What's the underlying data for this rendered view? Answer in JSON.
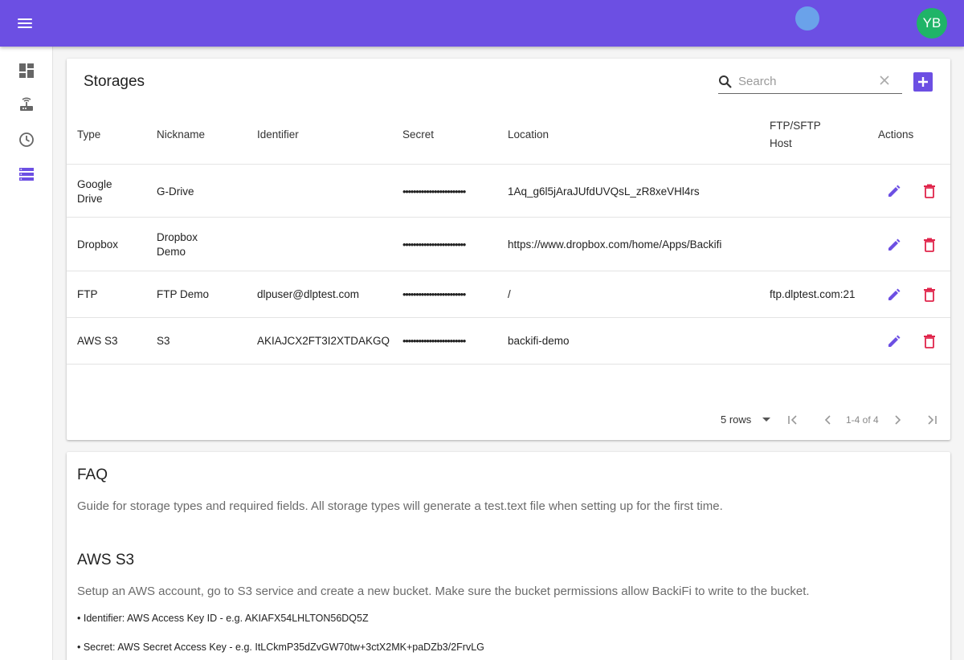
{
  "header": {
    "avatar_initials": "YB",
    "accent_color": "#6c4fe3"
  },
  "sidebar": {
    "items": [
      {
        "icon": "dashboard-icon"
      },
      {
        "icon": "router-icon"
      },
      {
        "icon": "clock-icon"
      },
      {
        "icon": "storage-icon",
        "active": true
      }
    ]
  },
  "storages": {
    "title": "Storages",
    "search_placeholder": "Search",
    "columns": {
      "type": "Type",
      "nickname": "Nickname",
      "identifier": "Identifier",
      "secret": "Secret",
      "location": "Location",
      "host_line1": "FTP/SFTP",
      "host_line2": "Host",
      "actions": "Actions"
    },
    "rows": [
      {
        "type_l1": "Google",
        "type_l2": "Drive",
        "nick_l1": "G-Drive",
        "nick_l2": "",
        "identifier": "",
        "secret": "••••••••••••••••••••••••",
        "location": "1Aq_g6l5jAraJUfdUVQsL_zR8xeVHl4rs",
        "host": ""
      },
      {
        "type_l1": "Dropbox",
        "type_l2": "",
        "nick_l1": "Dropbox",
        "nick_l2": "Demo",
        "identifier": "",
        "secret": "••••••••••••••••••••••••",
        "location": "https://www.dropbox.com/home/Apps/Backifi",
        "host": ""
      },
      {
        "type_l1": "FTP",
        "type_l2": "",
        "nick_l1": "FTP Demo",
        "nick_l2": "",
        "identifier": "dlpuser@dlptest.com",
        "secret": "••••••••••••••••••••••••",
        "location": "/",
        "host": "ftp.dlptest.com:21"
      },
      {
        "type_l1": "AWS S3",
        "type_l2": "",
        "nick_l1": "S3",
        "nick_l2": "",
        "identifier": "AKIAJCX2FT3I2XTDAKGQ",
        "secret": "••••••••••••••••••••••••",
        "location": "backifi-demo",
        "host": ""
      }
    ],
    "pagination": {
      "rows_label": "5 rows",
      "range": "1-4 of 4"
    }
  },
  "faq": {
    "title": "FAQ",
    "intro": "Guide for storage types and required fields. All storage types will generate a test.text file when setting up for the first time.",
    "aws_title": "AWS S3",
    "aws_desc": "Setup an AWS account, go to S3 service and create a new bucket. Make sure the bucket permissions allow BackiFi to write to the bucket.",
    "aws_identifier": "• Identifier: AWS Access Key ID - e.g. AKIAFX54LHLTON56DQ5Z",
    "aws_secret": "• Secret: AWS Secret Access Key - e.g. ItLCkmP35dZvGW70tw+3ctX2MK+paDZb3/2FrvLG"
  }
}
